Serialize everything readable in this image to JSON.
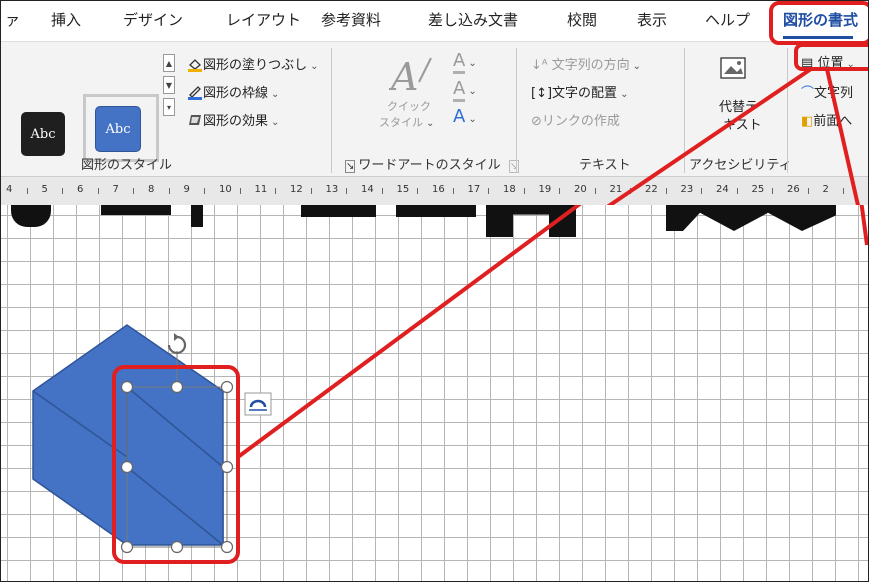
{
  "tabs": [
    {
      "label": "ァ"
    },
    {
      "label": "挿入"
    },
    {
      "label": "デザイン"
    },
    {
      "label": "レイアウト"
    },
    {
      "label": "参考資料"
    },
    {
      "label": "差し込み文書"
    },
    {
      "label": "校閲"
    },
    {
      "label": "表示"
    },
    {
      "label": "ヘルプ"
    },
    {
      "label": "図形の書式",
      "active": true
    }
  ],
  "ribbon": {
    "shape_styles": {
      "preset1": "Abc",
      "preset2": "Abc",
      "fill": "図形の塗りつぶし",
      "outline": "図形の枠線",
      "effects": "図形の効果",
      "group_label": "図形のスタイル"
    },
    "wordart": {
      "quick_style_line1": "クイック",
      "quick_style_line2": "スタイル",
      "group_label": "ワードアートのスタイル"
    },
    "text": {
      "direction": "文字列の方向",
      "align": "文字の配置",
      "link": "リンクの作成",
      "group_label": "テキスト"
    },
    "accessibility": {
      "alt_text_line1": "代替テ",
      "alt_text_line2": "キスト",
      "group_label": "アクセシビリティ"
    },
    "arrange": {
      "position": "位置",
      "wrap": "文字列",
      "front": "前面へ"
    }
  },
  "ruler": {
    "numbers": [
      "4",
      "5",
      "6",
      "7",
      "8",
      "9",
      "10",
      "11",
      "12",
      "13",
      "14",
      "15",
      "16",
      "17",
      "18",
      "19",
      "20",
      "21",
      "22",
      "23",
      "24",
      "25",
      "26",
      "2"
    ]
  },
  "colors": {
    "shape_fill": "#4472c4",
    "shape_stroke": "#2f5597",
    "highlight": "#e02020",
    "active_tab": "#1f4ea3"
  }
}
